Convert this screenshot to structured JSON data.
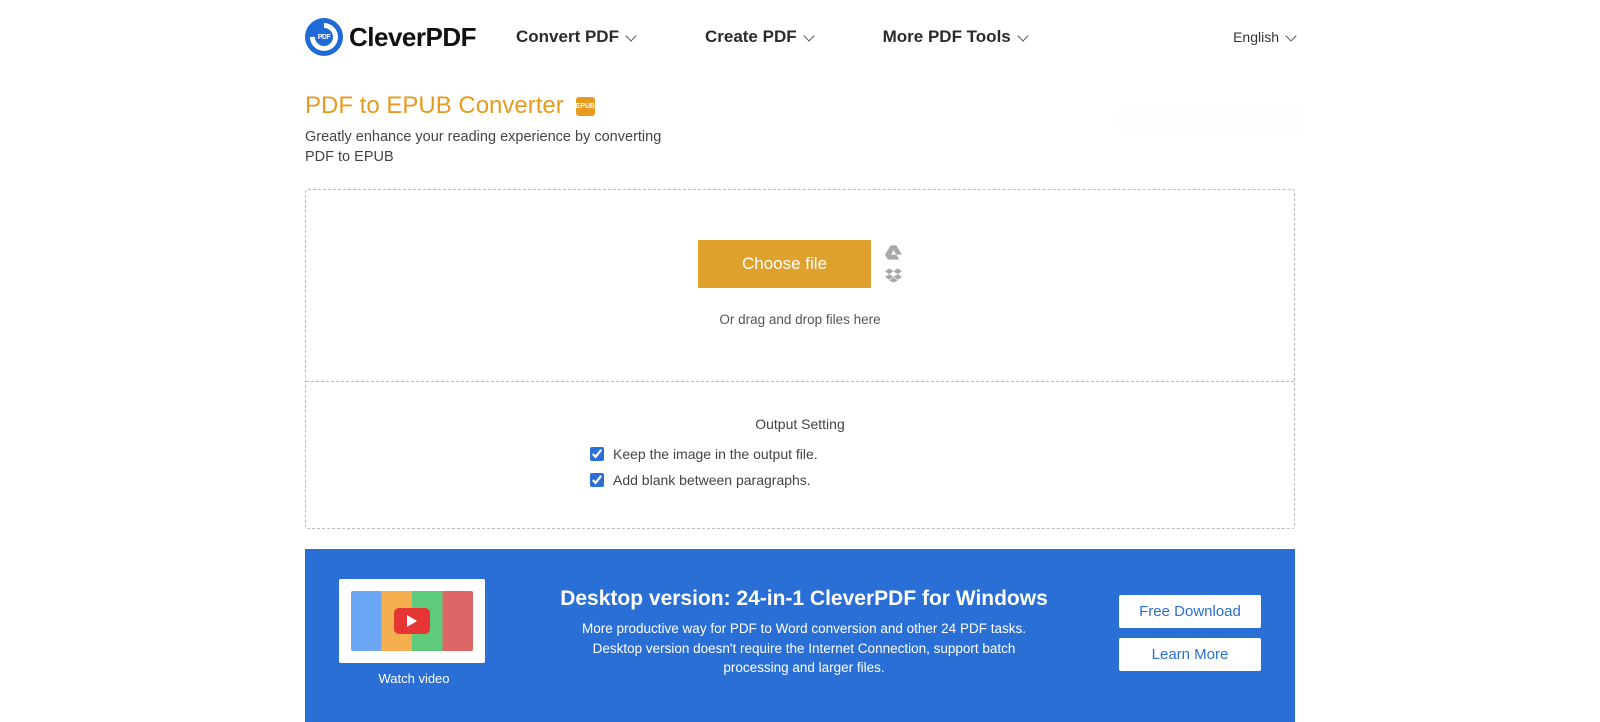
{
  "nav": {
    "brand": "CleverPDF",
    "menu": [
      "Convert PDF",
      "Create PDF",
      "More PDF Tools"
    ],
    "language": "English"
  },
  "page": {
    "title": "PDF to EPUB Converter",
    "iconLabel": "EPUB",
    "subtitle": "Greatly enhance your reading experience by converting PDF to EPUB"
  },
  "upload": {
    "button": "Choose file",
    "dragText": "Or drag and drop files here"
  },
  "settings": {
    "heading": "Output Setting",
    "options": [
      {
        "label": "Keep the image in the output file.",
        "checked": true
      },
      {
        "label": "Add blank between paragraphs.",
        "checked": true
      }
    ]
  },
  "banner": {
    "watch": "Watch video",
    "title": "Desktop version: 24-in-1 CleverPDF for Windows",
    "desc": "More productive way for PDF to Word conversion and other 24 PDF tasks. Desktop version doesn't require the Internet Connection, support batch processing and larger files.",
    "primary": "Free Download",
    "secondary": "Learn More"
  }
}
